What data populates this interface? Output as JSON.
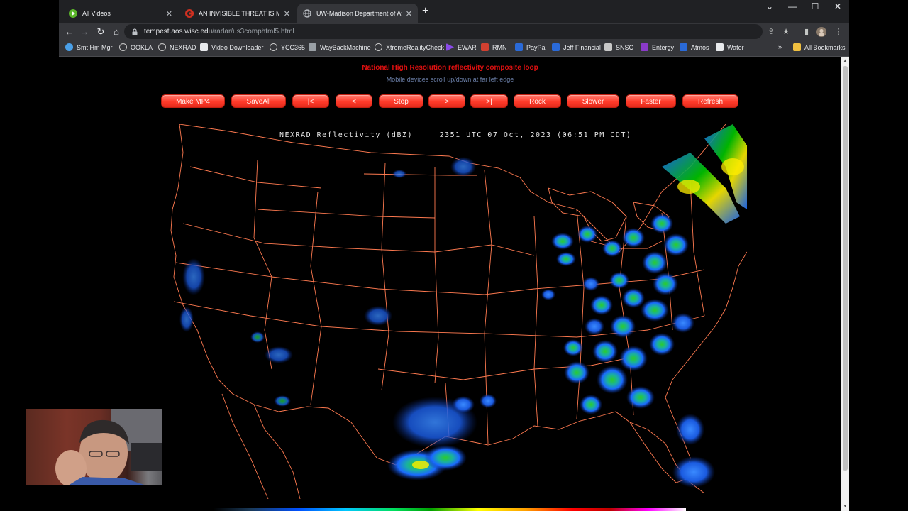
{
  "tabs": [
    {
      "title": "All Videos",
      "active": false,
      "icon": "play-icon"
    },
    {
      "title": "AN INVISIBLE THREAT IS MICROW",
      "active": false,
      "icon": "red-c-icon"
    },
    {
      "title": "UW-Madison Department of Atm",
      "active": true,
      "icon": "globe-icon"
    }
  ],
  "address_bar": {
    "host": "tempest.aos.wisc.edu",
    "path": "/radar/us3comphtml5.html"
  },
  "bookmarks": [
    {
      "label": "Smt Hm Mgr",
      "color": "#4aa0e8"
    },
    {
      "label": "OOKLA",
      "color": "#9aa0a6"
    },
    {
      "label": "NEXRAD",
      "color": "#9aa0a6"
    },
    {
      "label": "Video Downloader",
      "color": "#e8eaed"
    },
    {
      "label": "YCC365",
      "color": "#9aa0a6"
    },
    {
      "label": "WayBackMachine",
      "color": "#9aa0a6"
    },
    {
      "label": "XtremeRealityCheck",
      "color": "#9aa0a6"
    },
    {
      "label": "EWAR",
      "color": "#8a4ae8"
    },
    {
      "label": "RMN",
      "color": "#d04030"
    },
    {
      "label": "PayPal",
      "color": "#2a6ad8"
    },
    {
      "label": "Jeff Financial",
      "color": "#2a6ad8"
    },
    {
      "label": "SNSC",
      "color": "#c8c8c8"
    },
    {
      "label": "Entergy",
      "color": "#8a3ac8"
    },
    {
      "label": "Atmos",
      "color": "#2a6ad8"
    },
    {
      "label": "Water",
      "color": "#e8eaed"
    }
  ],
  "bookmarks_more": "»",
  "all_bookmarks": "All Bookmarks",
  "page": {
    "title": "National High Resolution reflectivity composite loop",
    "subtitle": "Mobile devices scroll up/down at far left edge",
    "buttons": [
      "Make MP4",
      "SaveAll",
      "|<",
      "<",
      "Stop",
      ">",
      ">|",
      "Rock",
      "Slower",
      "Faster",
      "Refresh"
    ],
    "radar_header": "NEXRAD Reflectivity (dBZ)     2351 UTC 07 Oct, 2023 (06:51 PM CDT)"
  },
  "colors": {
    "title_red": "#e01010",
    "button_red": "#ff3b2a",
    "border_orange": "#ff7a50",
    "echo_blue": "#1a6aff",
    "echo_green": "#00c800",
    "echo_yellow": "#ffee00"
  }
}
